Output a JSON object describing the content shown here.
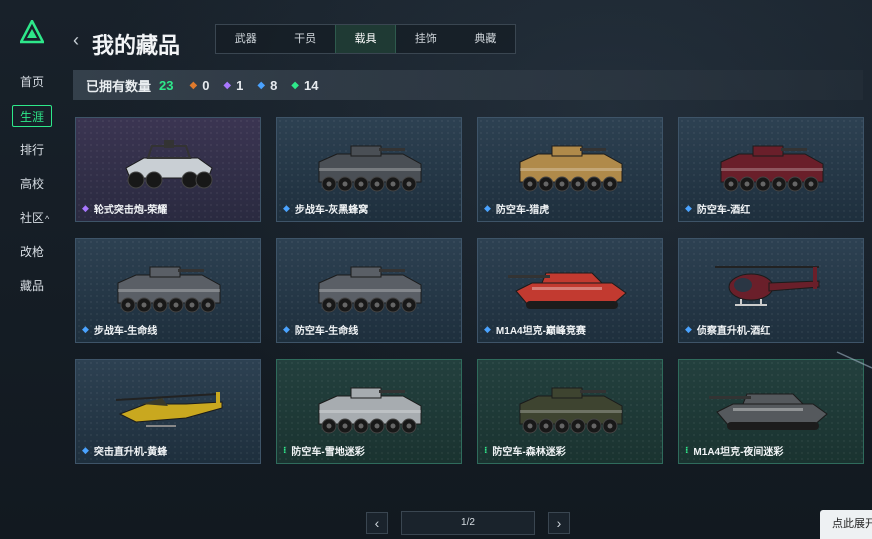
{
  "nav": {
    "items": [
      {
        "label": "首页",
        "active": false
      },
      {
        "label": "生涯",
        "active": true
      },
      {
        "label": "排行",
        "active": false
      },
      {
        "label": "高校",
        "active": false
      },
      {
        "label": "社区",
        "active": false,
        "caret": "^"
      },
      {
        "label": "改枪",
        "active": false
      },
      {
        "label": "藏品",
        "active": false
      }
    ]
  },
  "header": {
    "back_icon": "chevron-left-icon",
    "title": "我的藏品",
    "tabs": [
      {
        "label": "武器",
        "active": false
      },
      {
        "label": "干员",
        "active": false
      },
      {
        "label": "载具",
        "active": true
      },
      {
        "label": "挂饰",
        "active": false
      },
      {
        "label": "典藏",
        "active": false
      }
    ]
  },
  "stats": {
    "label": "已拥有数量",
    "total": "23",
    "rarities": [
      {
        "icon": "diamond-orange-icon",
        "color": "#e07a2c",
        "count": "0"
      },
      {
        "icon": "diamond-purple-icon",
        "color": "#a877ff",
        "count": "1"
      },
      {
        "icon": "diamond-blue-icon",
        "color": "#4aa3ff",
        "count": "8"
      },
      {
        "icon": "diamond-green-icon",
        "color": "#2ee88a",
        "count": "14"
      }
    ]
  },
  "items": [
    {
      "name": "轮式突击炮-荣耀",
      "rarity": "purple",
      "kind": "buggy",
      "paint": "#c9cfd4"
    },
    {
      "name": "步战车-灰黑蜂窝",
      "rarity": "blue",
      "kind": "apc",
      "paint": "#4a4f55"
    },
    {
      "name": "防空车-猎虎",
      "rarity": "blue",
      "kind": "apc",
      "paint": "#b08a4a"
    },
    {
      "name": "防空车-酒红",
      "rarity": "blue",
      "kind": "apc",
      "paint": "#6a1f2a"
    },
    {
      "name": "步战车-生命线",
      "rarity": "blue",
      "kind": "apc",
      "paint": "#5a5f66"
    },
    {
      "name": "防空车-生命线",
      "rarity": "blue",
      "kind": "apc",
      "paint": "#5a5f66"
    },
    {
      "name": "M1A4坦克-巅峰竞赛",
      "rarity": "blue",
      "kind": "tank",
      "paint": "#c23a30"
    },
    {
      "name": "侦察直升机-酒红",
      "rarity": "blue",
      "kind": "heli",
      "paint": "#6a1f2a"
    },
    {
      "name": "突击直升机-黄蜂",
      "rarity": "blue",
      "kind": "attack-heli",
      "paint": "#c9a81f"
    },
    {
      "name": "防空车-雪地迷彩",
      "rarity": "green",
      "kind": "apc",
      "paint": "#a7acb0"
    },
    {
      "name": "防空车-森林迷彩",
      "rarity": "green",
      "kind": "apc",
      "paint": "#3e4430"
    },
    {
      "name": "M1A4坦克-夜间迷彩",
      "rarity": "green",
      "kind": "tank",
      "paint": "#55595d"
    }
  ],
  "pagination": {
    "prev_icon": "chevron-left-icon",
    "next_icon": "chevron-right-icon",
    "page": "1/2"
  },
  "expand_tip": "点此展开"
}
